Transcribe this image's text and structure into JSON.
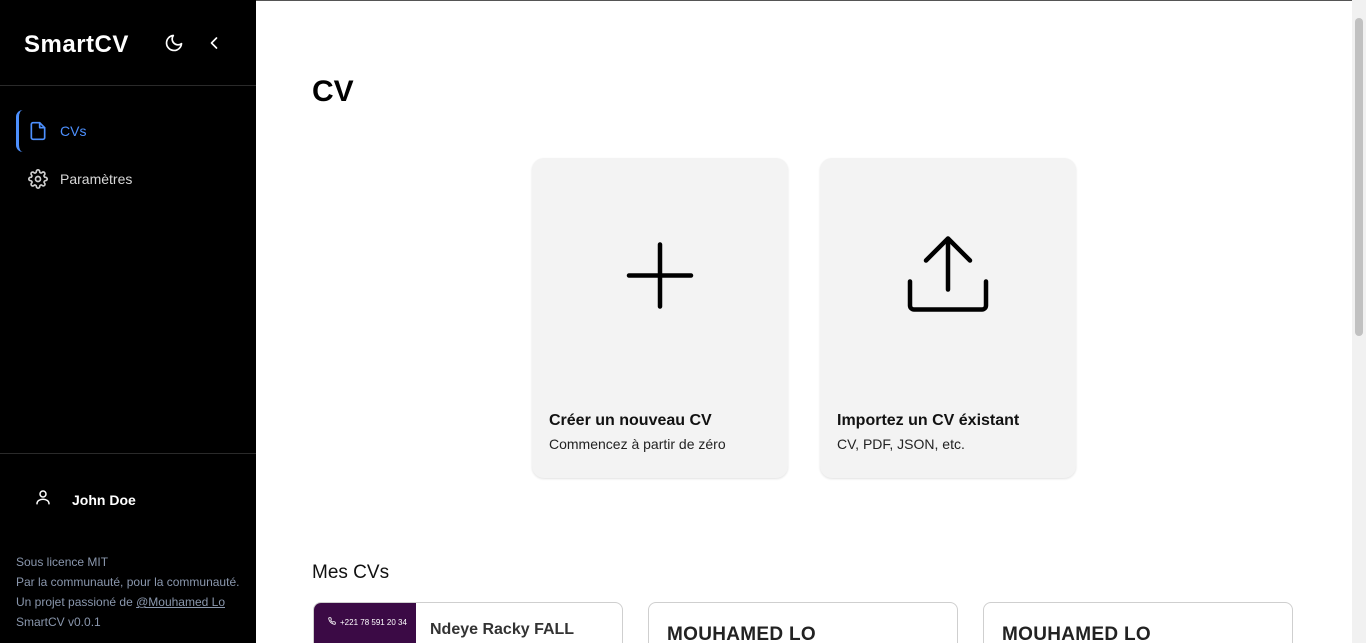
{
  "sidebar": {
    "brand": "SmartCV",
    "nav": [
      {
        "label": "CVs",
        "icon": "file-icon",
        "active": true
      },
      {
        "label": "Paramètres",
        "icon": "gear-icon",
        "active": false
      }
    ],
    "user": {
      "name": "John Doe",
      "icon": "user-icon"
    },
    "footer": {
      "license": "Sous licence MIT",
      "community": "Par la communauté, pour la communauté.",
      "project_prefix": "Un projet passioné de",
      "author_link": "@Mouhamed Lo",
      "version": "SmartCV v0.0.1"
    }
  },
  "main": {
    "title": "CV",
    "cards": [
      {
        "title": "Créer un nouveau CV",
        "subtitle": "Commencez à partir de zéro",
        "icon": "plus-icon"
      },
      {
        "title": "Importez un CV éxistant",
        "subtitle": "CV, PDF, JSON, etc.",
        "icon": "upload-icon"
      }
    ],
    "section_title": "Mes CVs",
    "cvs": [
      {
        "phone": "+221 78 591 20 34",
        "name": "Ndeye Racky FALL"
      },
      {
        "name": "MOUHAMED LO"
      },
      {
        "name": "MOUHAMED LO"
      }
    ]
  },
  "colors": {
    "sidebar_bg": "#000000",
    "accent": "#4d90fe",
    "card_bg": "#f3f3f3",
    "cv_band": "#3b0a45"
  }
}
